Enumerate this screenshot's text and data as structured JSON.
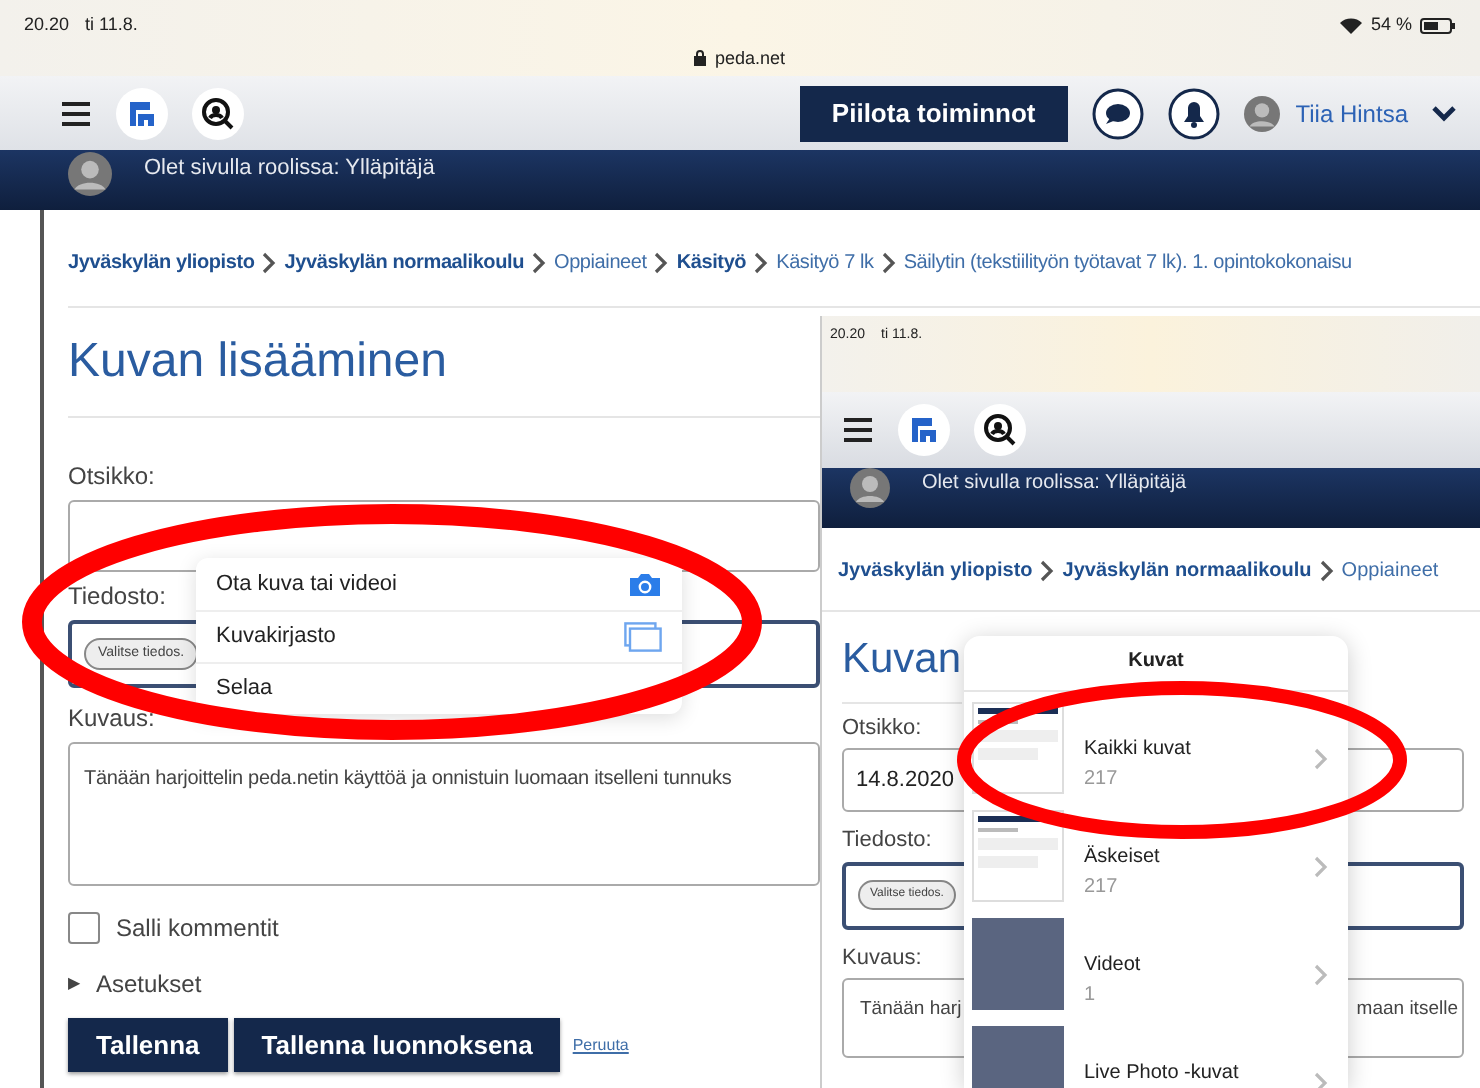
{
  "status_bar": {
    "time": "20.20",
    "date": "ti 11.8.",
    "url": "peda.net",
    "battery": "54 %"
  },
  "nav": {
    "hide_button": "Piilota toiminnot",
    "user_name": "Tiia Hintsa"
  },
  "role_banner": "Olet sivulla roolissa: Ylläpitäjä",
  "breadcrumb": [
    "Jyväskylän yliopisto",
    "Jyväskylän normaalikoulu",
    "Oppiaineet",
    "Käsityö",
    "Käsityö 7 lk",
    "Säilytin (tekstiilityön työtavat 7 lk). 1. opintokokonaisu"
  ],
  "page_title": "Kuvan lisääminen",
  "form": {
    "title_label": "Otsikko:",
    "file_label": "Tiedosto:",
    "file_button": "Valitse tiedos.",
    "description_label": "Kuvaus:",
    "description": "Tänään harjoittelin peda.netin käyttöä ja onnistuin luomaan itselleni tunnuks",
    "allow_comments": {
      "label": "Salli kommentit",
      "checked": false
    },
    "settings": {
      "label": "Asetukset",
      "expanded": false,
      "toggle": "▶"
    },
    "buttons": [
      "Tallenna",
      "Tallenna luonnoksena"
    ],
    "cancel_link": "Peruuta"
  },
  "file_menu": [
    {
      "label": "Ota kuva tai videoi",
      "kind": "camera"
    },
    {
      "label": "Kuvakirjasto",
      "kind": "library"
    },
    {
      "label": "Selaa",
      "kind": "none"
    }
  ],
  "second_screenshot": {
    "status_bar": {
      "time": "20.20",
      "date": "ti 11.8."
    },
    "role_banner": "Olet sivulla roolissa: Ylläpitäjä",
    "breadcrumb": [
      "Jyväskylän yliopisto",
      "Jyväskylän normaalikoulu",
      "Oppiaineet"
    ],
    "page_title": "Kuvan",
    "title_label": "Otsikko:",
    "title_value": "14.8.2020",
    "file_label": "Tiedosto:",
    "file_button": "Valitse tiedos.",
    "description_label": "Kuvaus:",
    "description_start": "Tänään harj",
    "description_end": "maan itselle",
    "photo_picker": {
      "title": "Kuvat",
      "albums": [
        {
          "name": "Kaikki kuvat",
          "count": "217",
          "kind": "screenshot"
        },
        {
          "name": "Äskeiset",
          "count": "217",
          "kind": "screenshot"
        },
        {
          "name": "Videot",
          "count": "1",
          "kind": "photo"
        },
        {
          "name": "Live Photo -kuvat",
          "kind": "photo"
        }
      ]
    }
  }
}
